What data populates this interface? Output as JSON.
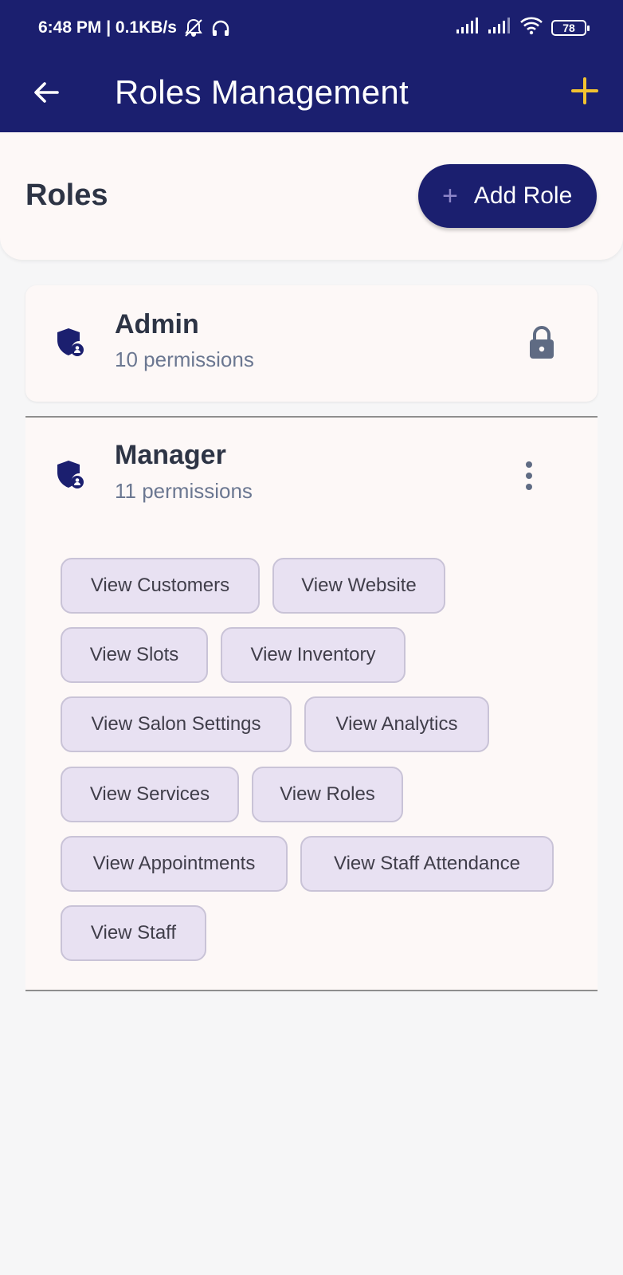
{
  "status_bar": {
    "time": "6:48 PM | 0.1KB/s",
    "battery": "78"
  },
  "app_bar": {
    "title": "Roles Management"
  },
  "header": {
    "heading": "Roles",
    "add_role_label": "Add Role"
  },
  "roles": [
    {
      "name": "Admin",
      "permissions_count": "10 permissions",
      "status": "locked"
    },
    {
      "name": "Manager",
      "permissions_count": "11 permissions",
      "permissions": [
        "View Customers",
        "View Website",
        "View Slots",
        "View Inventory",
        "View Salon Settings",
        "View Analytics",
        "View Services",
        "View Roles",
        "View Appointments",
        "View Staff Attendance",
        "View Staff"
      ]
    }
  ],
  "colors": {
    "primary": "#1b1f6f",
    "accent_plus": "#f2c230",
    "chip_background": "#e8e1f2",
    "surface": "#fdf8f7"
  }
}
